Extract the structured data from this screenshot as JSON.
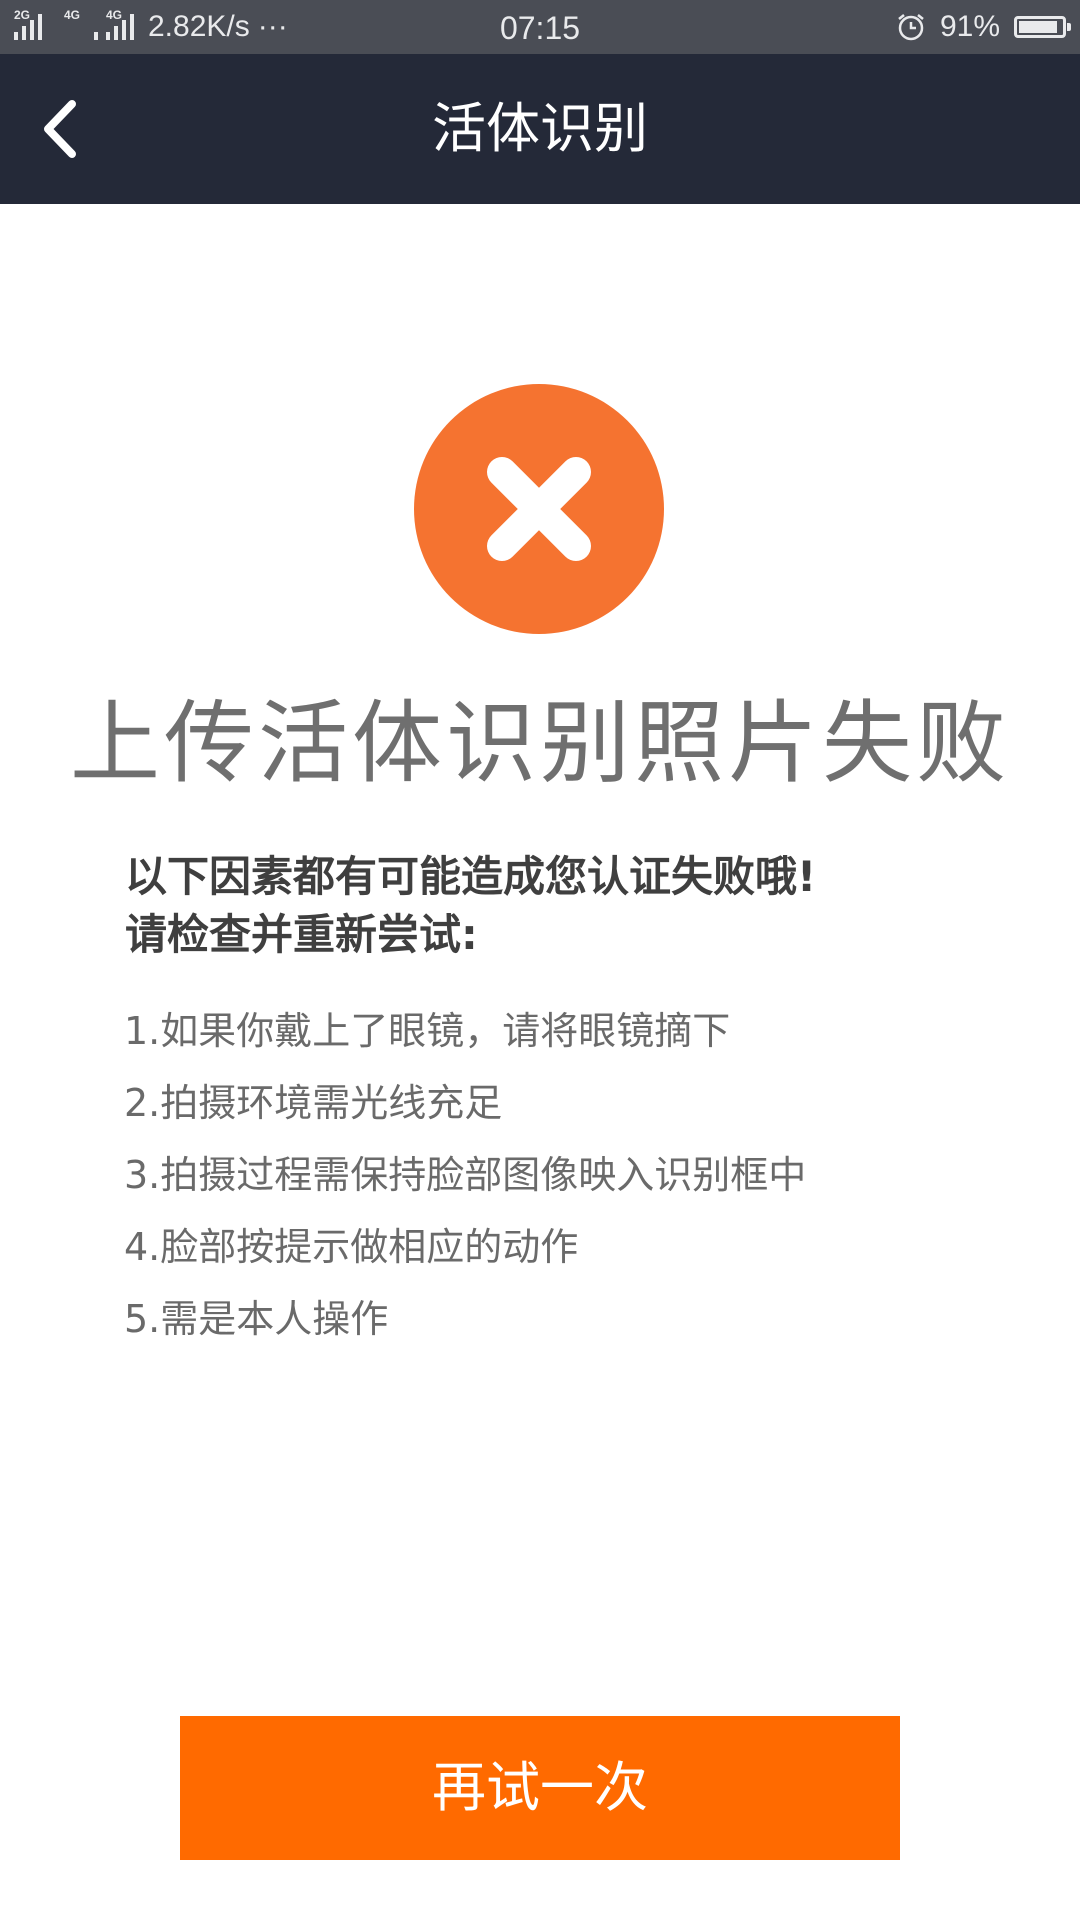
{
  "status_bar": {
    "network_1": "2G",
    "network_2": "4G",
    "network_3": "4G",
    "speed": "2.82K/s",
    "more": "···",
    "time": "07:15",
    "battery_percent": "91%",
    "battery_level": 0.91,
    "icons": [
      "signal-icon",
      "alarm-icon",
      "battery-icon"
    ]
  },
  "nav": {
    "title": "活体识别",
    "back_icon": "chevron-left-icon"
  },
  "result": {
    "icon": "close-icon",
    "icon_color": "#f57330",
    "title": "上传活体识别照片失败"
  },
  "reasons": {
    "header_line1": "以下因素都有可能造成您认证失败哦!",
    "header_line2": "请检查并重新尝试:",
    "items": [
      "1.如果你戴上了眼镜，请将眼镜摘下",
      "2.拍摄环境需光线充足",
      "3.拍摄过程需保持脸部图像映入识别框中",
      "4.脸部按提示做相应的动作",
      "5.需是本人操作"
    ]
  },
  "retry": {
    "label": "再试一次",
    "color": "#ff6a00"
  }
}
